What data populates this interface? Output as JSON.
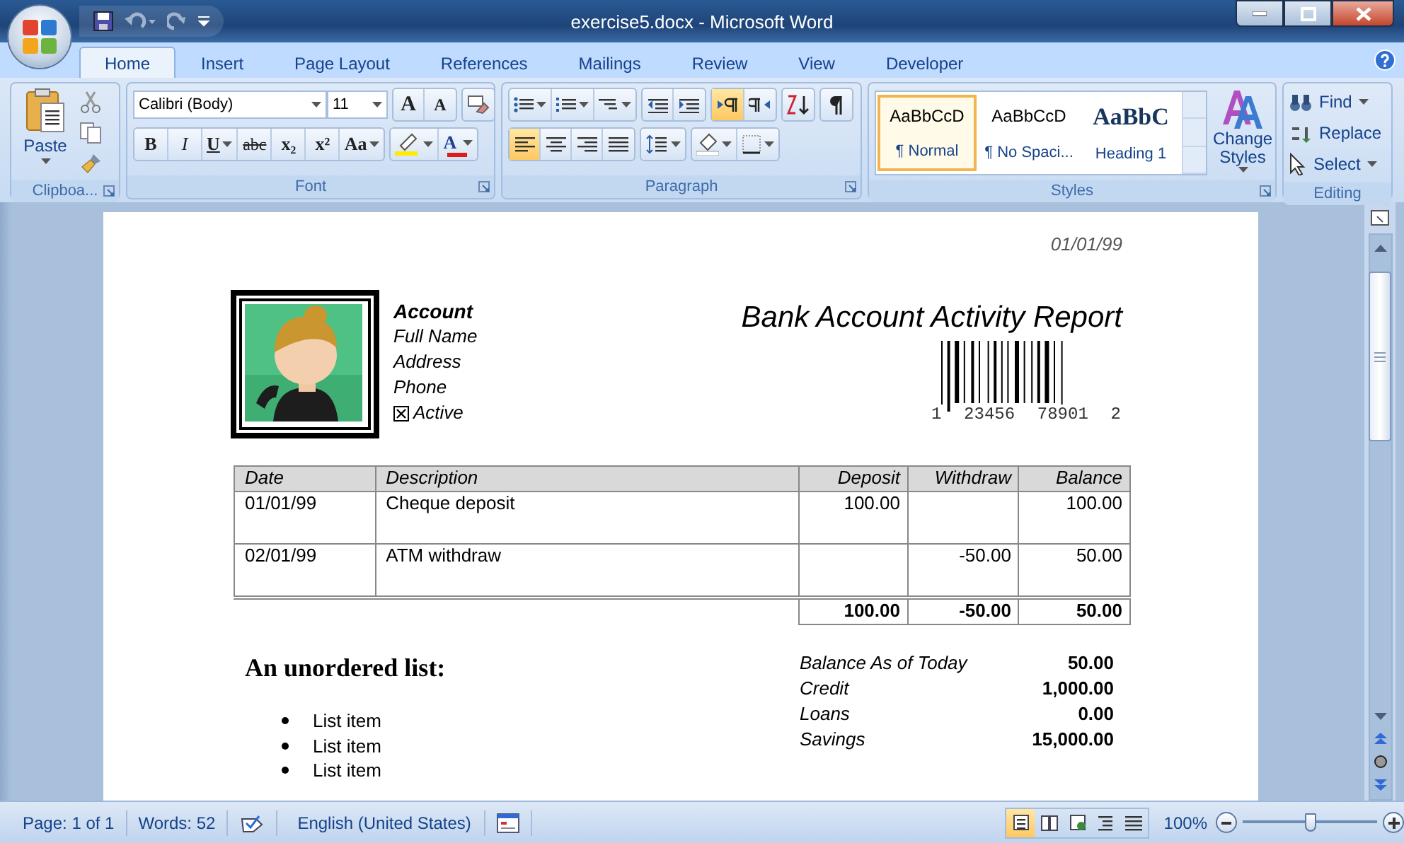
{
  "window": {
    "title": "exercise5.docx - Microsoft Word"
  },
  "tabs": [
    {
      "label": "Home",
      "selected": true
    },
    {
      "label": "Insert",
      "selected": false
    },
    {
      "label": "Page Layout",
      "selected": false
    },
    {
      "label": "References",
      "selected": false
    },
    {
      "label": "Mailings",
      "selected": false
    },
    {
      "label": "Review",
      "selected": false
    },
    {
      "label": "View",
      "selected": false
    },
    {
      "label": "Developer",
      "selected": false
    }
  ],
  "ribbon": {
    "clipboard": {
      "paste": "Paste",
      "label": "Clipboa..."
    },
    "font": {
      "font_name": "Calibri (Body)",
      "font_size": "11",
      "size_buttons": [
        "A",
        "A"
      ],
      "format_buttons": [
        {
          "label": "B",
          "kind": "bold"
        },
        {
          "label": "I",
          "kind": "italic"
        },
        {
          "label": "U",
          "kind": "underline"
        },
        {
          "label": "abc",
          "kind": "strike"
        },
        {
          "label": "x₂",
          "kind": "sub"
        },
        {
          "label": "x²",
          "kind": "sup"
        },
        {
          "label": "Aa",
          "kind": "case"
        }
      ],
      "font_color_label": "A",
      "label": "Font"
    },
    "paragraph": {
      "direction": [
        {
          "kind": "ltr",
          "selected": true
        },
        {
          "kind": "rtl",
          "selected": false
        }
      ],
      "alignment": [
        {
          "kind": "left",
          "selected": true
        },
        {
          "kind": "center",
          "selected": false
        },
        {
          "kind": "right",
          "selected": false
        },
        {
          "kind": "justify",
          "selected": false
        }
      ],
      "label": "Paragraph"
    },
    "styles": {
      "gallery": [
        {
          "preview": "AaBbCcD",
          "name": "¶ Normal",
          "kind": "normal",
          "selected": true
        },
        {
          "preview": "AaBbCcD",
          "name": "¶ No Spaci...",
          "kind": "normal",
          "selected": false
        },
        {
          "preview": "AaBbC",
          "name": "Heading 1",
          "kind": "heading",
          "selected": false
        }
      ],
      "change_styles": "Change Styles",
      "label": "Styles"
    },
    "editing": {
      "buttons": [
        {
          "label": "Find",
          "kind": "find"
        },
        {
          "label": "Replace",
          "kind": "replace"
        },
        {
          "label": "Select",
          "kind": "select"
        }
      ],
      "label": "Editing"
    }
  },
  "document": {
    "date": "01/01/99",
    "account": {
      "heading": "Account",
      "lines": [
        "Full Name",
        "Address",
        "Phone"
      ],
      "active": {
        "label": "Active",
        "checked": true
      }
    },
    "title": "Bank Account Activity Report",
    "barcode_digits": [
      "1",
      "23456",
      "78901",
      "2"
    ],
    "table": {
      "columns": [
        "Date",
        "Description",
        "Deposit",
        "Withdraw",
        "Balance"
      ],
      "rows": [
        [
          "01/01/99",
          "Cheque deposit",
          "100.00",
          "",
          "100.00"
        ],
        [
          "02/01/99",
          "ATM withdraw",
          "",
          "-50.00",
          "50.00"
        ]
      ],
      "totals": [
        "100.00",
        "-50.00",
        "50.00"
      ]
    },
    "list_heading": "An unordered list:",
    "list_items": [
      "List item",
      "List item",
      "List item"
    ],
    "summary": [
      {
        "label": "Balance As of Today",
        "value": "50.00"
      },
      {
        "label": "Credit",
        "value": "1,000.00"
      },
      {
        "label": "Loans",
        "value": "0.00"
      },
      {
        "label": "Savings",
        "value": "15,000.00"
      }
    ]
  },
  "status_bar": {
    "page": "Page: 1 of 1",
    "words": "Words: 52",
    "language": "English (United States)",
    "views": [
      {
        "kind": "print",
        "selected": true
      },
      {
        "kind": "reading",
        "selected": false
      },
      {
        "kind": "web",
        "selected": false
      },
      {
        "kind": "outline",
        "selected": false
      },
      {
        "kind": "draft",
        "selected": false
      }
    ],
    "zoom": "100%",
    "zoom_slider": {
      "level": 0.5
    }
  }
}
